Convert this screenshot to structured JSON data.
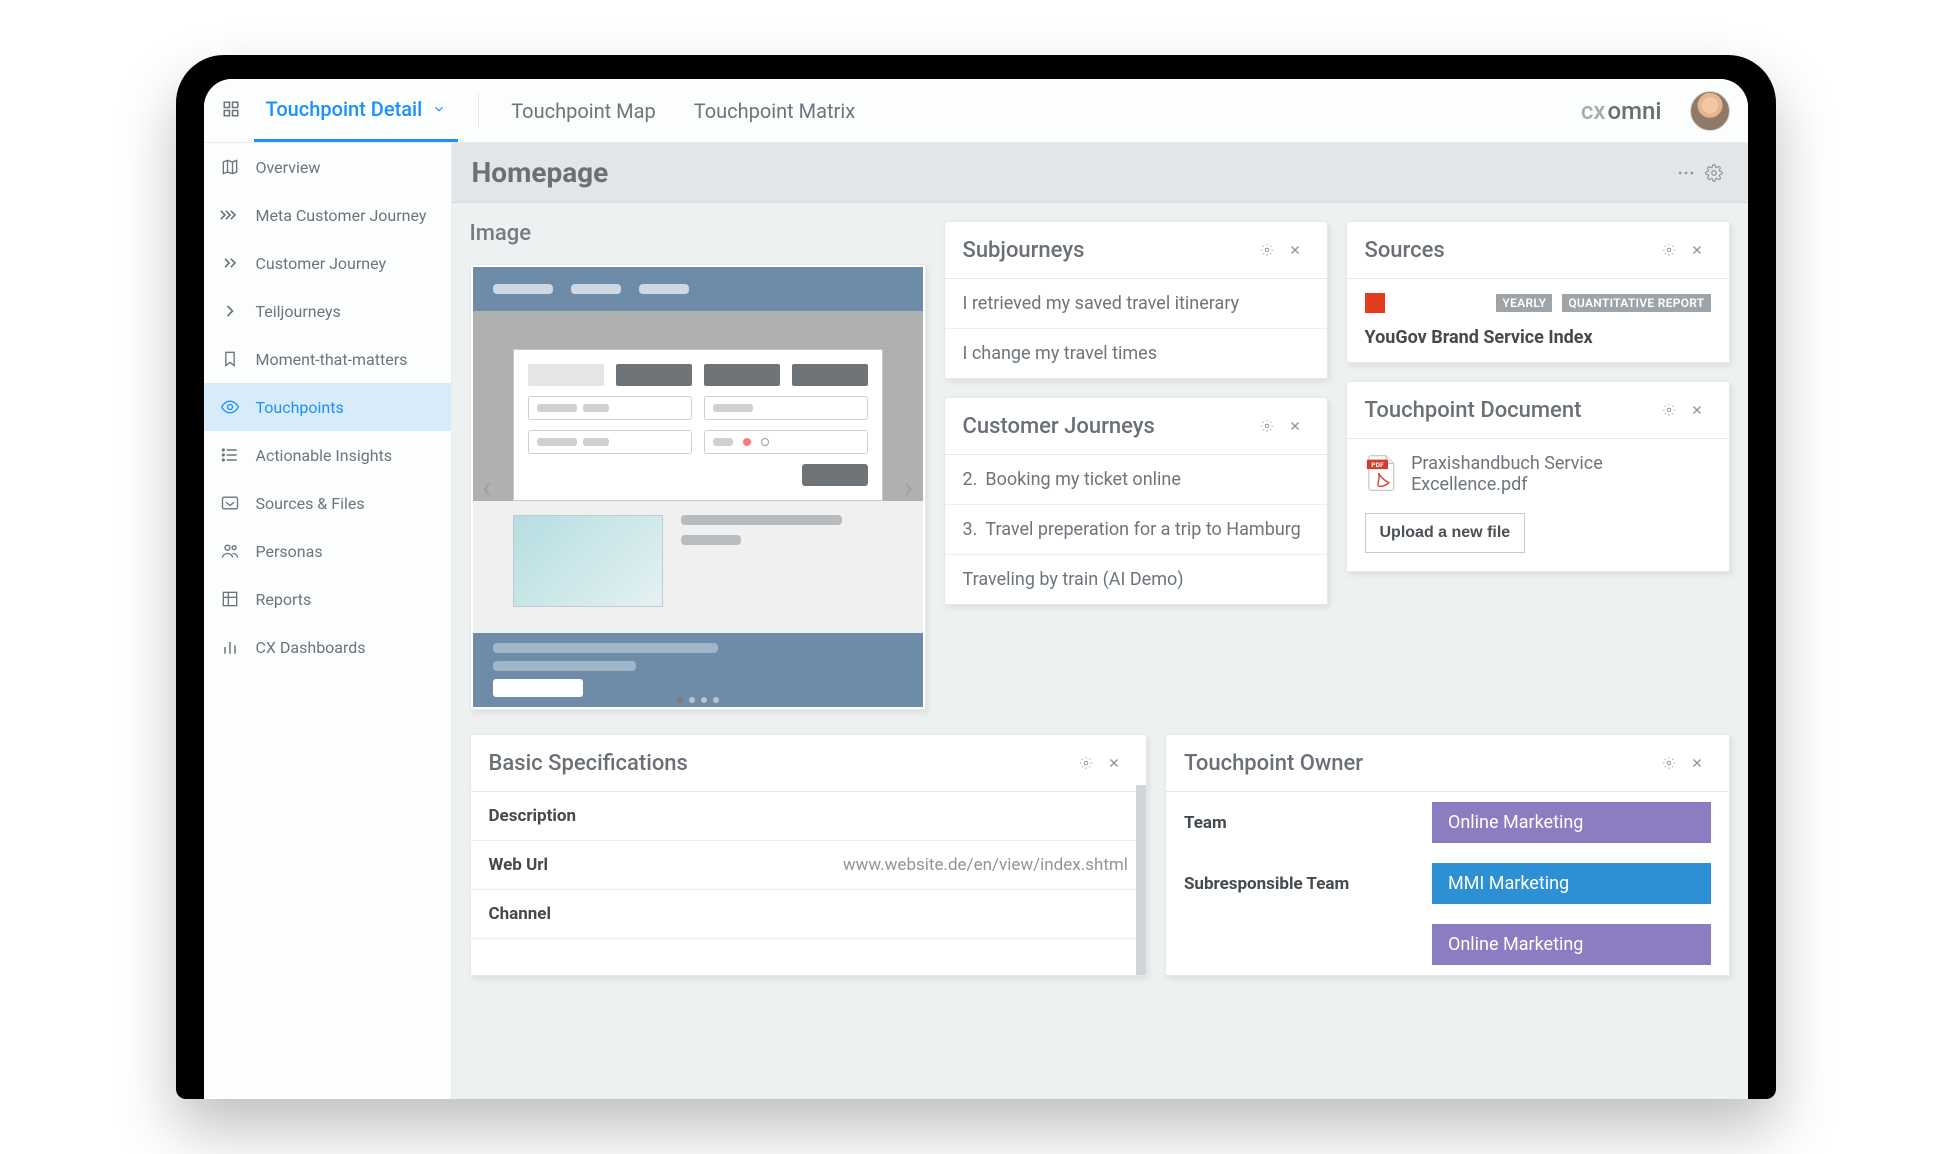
{
  "topnav": {
    "tabs": [
      "Touchpoint Detail",
      "Touchpoint Map",
      "Touchpoint Matrix"
    ],
    "active_index": 0,
    "brand_prefix": "cx",
    "brand_suffix": "omni"
  },
  "sidebar": {
    "items": [
      {
        "label": "Overview",
        "icon": "map"
      },
      {
        "label": "Meta Customer Journey",
        "icon": "chevrons"
      },
      {
        "label": "Customer Journey",
        "icon": "chevrons"
      },
      {
        "label": "Teiljourneys",
        "icon": "chevron"
      },
      {
        "label": "Moment-that-matters",
        "icon": "bookmark"
      },
      {
        "label": "Touchpoints",
        "icon": "eye"
      },
      {
        "label": "Actionable Insights",
        "icon": "list"
      },
      {
        "label": "Sources & Files",
        "icon": "inbox"
      },
      {
        "label": "Personas",
        "icon": "users"
      },
      {
        "label": "Reports",
        "icon": "table"
      },
      {
        "label": "CX Dashboards",
        "icon": "bars"
      }
    ],
    "active_index": 5
  },
  "page": {
    "title": "Homepage",
    "image_title": "Image"
  },
  "subjourneys": {
    "title": "Subjourneys",
    "items": [
      "I retrieved my saved travel itinerary",
      "I change my travel times"
    ]
  },
  "customer_journeys": {
    "title": "Customer Journeys",
    "items": [
      {
        "prefix": "2.",
        "label": "Booking my ticket online"
      },
      {
        "prefix": "3.",
        "label": "Travel preperation for a trip to Hamburg"
      },
      {
        "prefix": "",
        "label": "Traveling by train (AI Demo)"
      }
    ]
  },
  "sources": {
    "title": "Sources",
    "swatch_color": "#e23b1f",
    "tags": [
      "YEARLY",
      "QUANTITATIVE REPORT"
    ],
    "item_title": "YouGov Brand Service Index"
  },
  "touchpoint_doc": {
    "title": "Touchpoint Document",
    "file_name": "Praxishandbuch Service Excellence.pdf",
    "upload_label": "Upload a new file",
    "pdf_badge": "PDF"
  },
  "basic_specs": {
    "title": "Basic Specifications",
    "rows": [
      {
        "label": "Description",
        "value": ""
      },
      {
        "label": "Web Url",
        "value": "www.website.de/en/view/index.shtml"
      },
      {
        "label": "Channel",
        "value": ""
      }
    ]
  },
  "owner": {
    "title": "Touchpoint Owner",
    "rows": [
      {
        "label": "Team",
        "chip": "Online Marketing",
        "color": "purple"
      },
      {
        "label": "Subresponsible Team",
        "chip": "MMI Marketing",
        "color": "blue"
      },
      {
        "label": "",
        "chip": "Online Marketing",
        "color": "purple2"
      }
    ]
  }
}
